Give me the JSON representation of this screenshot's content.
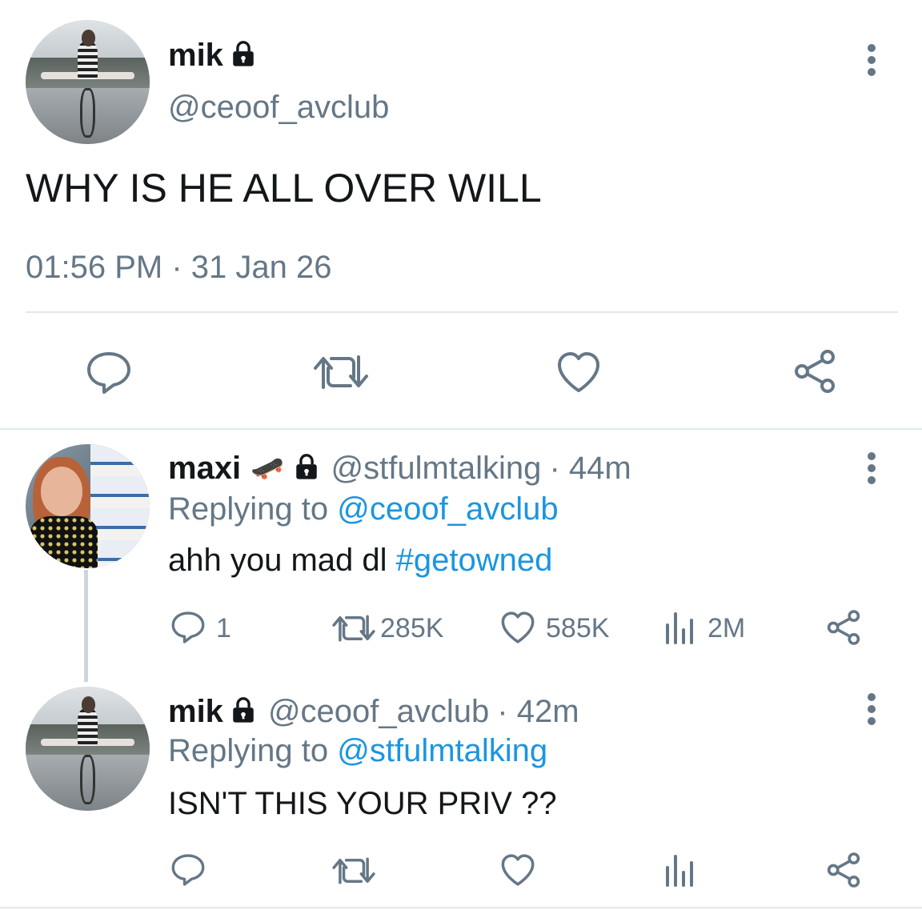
{
  "main_tweet": {
    "name": "mik",
    "handle": "@ceoof_avclub",
    "text": "WHY IS HE ALL OVER WILL",
    "timestamp": "01:56 PM · 31 Jan 26",
    "actions": [
      "reply-icon",
      "retweet-icon",
      "like-icon",
      "share-icon"
    ]
  },
  "replies": [
    {
      "name": "maxi",
      "emoji": "🛹",
      "handle": "@stfulmtalking",
      "time": "· 44m",
      "replying_prefix": "Replying to",
      "replying_to": "@ceoof_avclub",
      "text": "ahh you mad dl",
      "hashtag": "#getowned",
      "stats": {
        "replies": "1",
        "retweets": "285K",
        "likes": "585K",
        "views": "2M"
      }
    },
    {
      "name": "mik",
      "handle": "@ceoof_avclub",
      "time": "· 42m",
      "replying_prefix": "Replying to",
      "replying_to": "@stfulmtalking",
      "text": "ISN'T THIS YOUR PRIV ??"
    }
  ],
  "colors": {
    "text": "#14171a",
    "secondary": "#657786",
    "link": "#1b95e0",
    "divider": "#e1e8ed"
  }
}
